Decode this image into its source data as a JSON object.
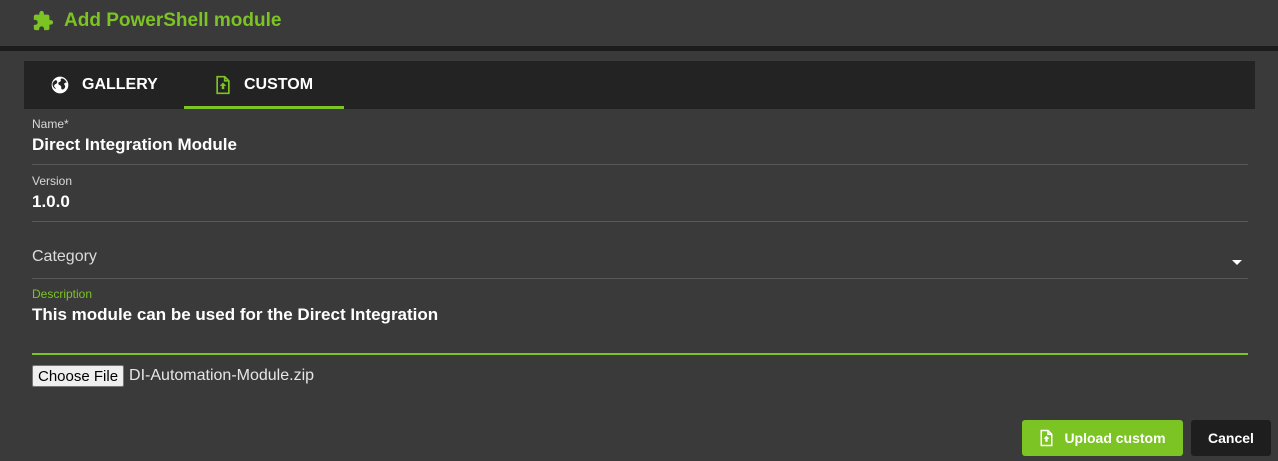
{
  "header": {
    "title": "Add PowerShell module",
    "icon": "puzzle-icon",
    "accent": "#7cc324"
  },
  "tabs": [
    {
      "label": "GALLERY",
      "icon": "globe-icon",
      "active": false
    },
    {
      "label": "CUSTOM",
      "icon": "file-upload-icon",
      "active": true
    }
  ],
  "form": {
    "name": {
      "label": "Name*",
      "value": "Direct Integration Module"
    },
    "version": {
      "label": "Version",
      "value": "1.0.0"
    },
    "category": {
      "label": "Category",
      "value": ""
    },
    "description": {
      "label": "Description",
      "value": "This module can be used for the Direct Integration"
    },
    "file": {
      "button_label": "Choose File",
      "filename": "DI-Automation-Module.zip"
    }
  },
  "actions": {
    "upload_label": "Upload custom",
    "cancel_label": "Cancel"
  }
}
